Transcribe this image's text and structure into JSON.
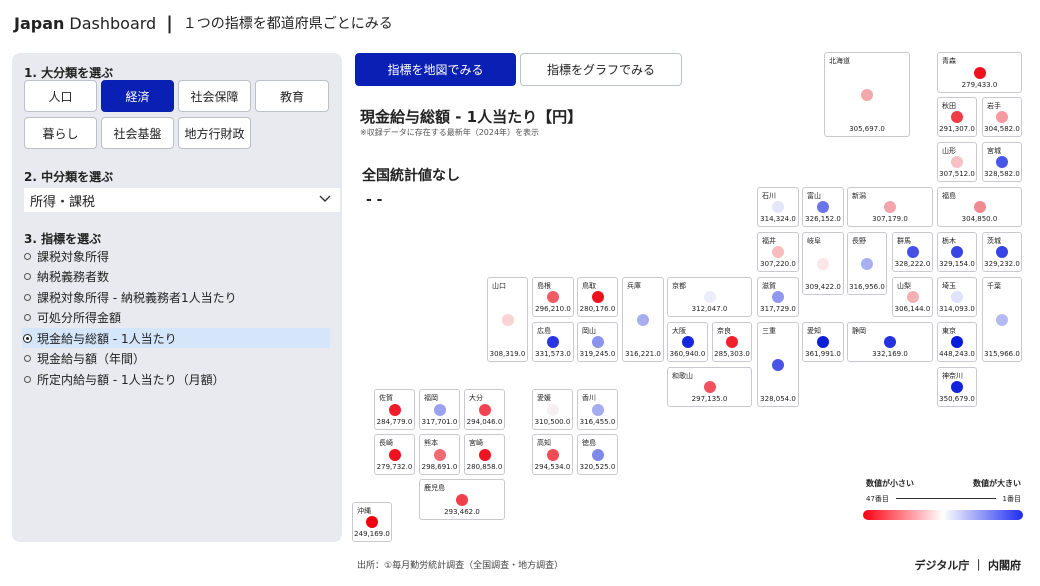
{
  "header": {
    "brand1": "Japan",
    "brand2": "Dashboard",
    "separator": "|",
    "title": "１つの指標を都道府県ごとにみる"
  },
  "sidebar": {
    "section1": "1. 大分類を選ぶ",
    "categories": [
      {
        "label": "人口",
        "active": false
      },
      {
        "label": "経済",
        "active": true
      },
      {
        "label": "社会保障",
        "active": false
      },
      {
        "label": "教育",
        "active": false
      },
      {
        "label": "暮らし",
        "active": false
      },
      {
        "label": "社会基盤",
        "active": false
      },
      {
        "label": "地方行財政",
        "active": false
      }
    ],
    "section2": "2. 中分類を選ぶ",
    "select_value": "所得・課税",
    "section3": "3. 指標を選ぶ",
    "indicators": [
      {
        "label": "課税対象所得",
        "selected": false
      },
      {
        "label": "納税義務者数",
        "selected": false
      },
      {
        "label": "課税対象所得 - 納税義務者1人当たり",
        "selected": false
      },
      {
        "label": "可処分所得金額",
        "selected": false
      },
      {
        "label": "現金給与総額 - 1人当たり",
        "selected": true
      },
      {
        "label": "現金給与額（年間）",
        "selected": false
      },
      {
        "label": "所定内給与額 - 1人当たり（月額）",
        "selected": false
      }
    ]
  },
  "tabs": {
    "map": "指標を地図でみる",
    "graph": "指標をグラフでみる"
  },
  "main": {
    "title": "現金給与総額 - 1人当たり【円】",
    "subtitle": "※収録データに存在する最新年（2024年）を表示",
    "national_label": "全国統計値なし",
    "national_value": "- -"
  },
  "prefectures": [
    {
      "name": "北海道",
      "value": "305,697.0",
      "color": "#f2a8ad"
    },
    {
      "name": "青森",
      "value": "279,433.0",
      "color": "#f0101e"
    },
    {
      "name": "秋田",
      "value": "291,307.0",
      "color": "#f03a45"
    },
    {
      "name": "岩手",
      "value": "304,582.0",
      "color": "#f59aa1"
    },
    {
      "name": "山形",
      "value": "307,512.0",
      "color": "#f7c0c4"
    },
    {
      "name": "宮城",
      "value": "328,582.0",
      "color": "#4a56e8"
    },
    {
      "name": "石川",
      "value": "314,324.0",
      "color": "#e4e6fa"
    },
    {
      "name": "富山",
      "value": "326,152.0",
      "color": "#6b75ea"
    },
    {
      "name": "新潟",
      "value": "307,179.0",
      "color": "#f4a5ab"
    },
    {
      "name": "福島",
      "value": "304,850.0",
      "color": "#f08a92"
    },
    {
      "name": "福井",
      "value": "307,220.0",
      "color": "#f7bcc0"
    },
    {
      "name": "岐阜",
      "value": "309,422.0",
      "color": "#fbe6e8"
    },
    {
      "name": "長野",
      "value": "316,956.0",
      "color": "#a9b0f2"
    },
    {
      "name": "群馬",
      "value": "328,222.0",
      "color": "#4550e6"
    },
    {
      "name": "栃木",
      "value": "329,154.0",
      "color": "#3844e4"
    },
    {
      "name": "茨城",
      "value": "329,232.0",
      "color": "#3743e4"
    },
    {
      "name": "山口",
      "value": "308,319.0",
      "color": "#f9d2d5"
    },
    {
      "name": "島根",
      "value": "296,210.0",
      "color": "#f05c66"
    },
    {
      "name": "鳥取",
      "value": "280,176.0",
      "color": "#f0111f"
    },
    {
      "name": "兵庫",
      "value": "316,221.0",
      "color": "#a7aef0"
    },
    {
      "name": "京都",
      "value": "312,047.0",
      "color": "#eceefb"
    },
    {
      "name": "滋賀",
      "value": "317,729.0",
      "color": "#9099ee"
    },
    {
      "name": "山梨",
      "value": "306,144.0",
      "color": "#f3b1b6"
    },
    {
      "name": "埼玉",
      "value": "314,093.0",
      "color": "#dfe2fa"
    },
    {
      "name": "千葉",
      "value": "315,966.0",
      "color": "#b5baf3"
    },
    {
      "name": "広島",
      "value": "331,573.0",
      "color": "#2a36e2"
    },
    {
      "name": "岡山",
      "value": "319,245.0",
      "color": "#8a93ee"
    },
    {
      "name": "大阪",
      "value": "360,940.0",
      "color": "#1626dc"
    },
    {
      "name": "奈良",
      "value": "285,303.0",
      "color": "#f0202d"
    },
    {
      "name": "三重",
      "value": "328,054.0",
      "color": "#4954e6"
    },
    {
      "name": "愛知",
      "value": "361,991.0",
      "color": "#0e1fda"
    },
    {
      "name": "静岡",
      "value": "332,169.0",
      "color": "#2532e0"
    },
    {
      "name": "東京",
      "value": "448,243.0",
      "color": "#0a1adc"
    },
    {
      "name": "和歌山",
      "value": "297,135.0",
      "color": "#f0525d"
    },
    {
      "name": "神奈川",
      "value": "350,679.0",
      "color": "#1222dc"
    },
    {
      "name": "佐賀",
      "value": "284,779.0",
      "color": "#f01c29"
    },
    {
      "name": "福岡",
      "value": "317,701.0",
      "color": "#9aa2ef"
    },
    {
      "name": "大分",
      "value": "294,046.0",
      "color": "#f04550"
    },
    {
      "name": "愛媛",
      "value": "310,500.0",
      "color": "#f7f0f2"
    },
    {
      "name": "香川",
      "value": "316,455.0",
      "color": "#a5acf0"
    },
    {
      "name": "長崎",
      "value": "279,732.0",
      "color": "#f0101e"
    },
    {
      "name": "熊本",
      "value": "298,691.0",
      "color": "#f26b74"
    },
    {
      "name": "宮崎",
      "value": "280,858.0",
      "color": "#f01422"
    },
    {
      "name": "高知",
      "value": "294,534.0",
      "color": "#f04a55"
    },
    {
      "name": "徳島",
      "value": "320,525.0",
      "color": "#7f89ec"
    },
    {
      "name": "鹿児島",
      "value": "293,462.0",
      "color": "#f0404b"
    },
    {
      "name": "沖縄",
      "value": "249,169.0",
      "color": "#f00010"
    }
  ],
  "legend": {
    "small": "数値が小さい",
    "large": "数値が大きい",
    "rank_low": "47番目",
    "rank_high": "1番目"
  },
  "source": "出所：①毎月勤労統計調査（全国調査・地方調査）",
  "footer": "デジタル庁 ｜ 内閣府"
}
